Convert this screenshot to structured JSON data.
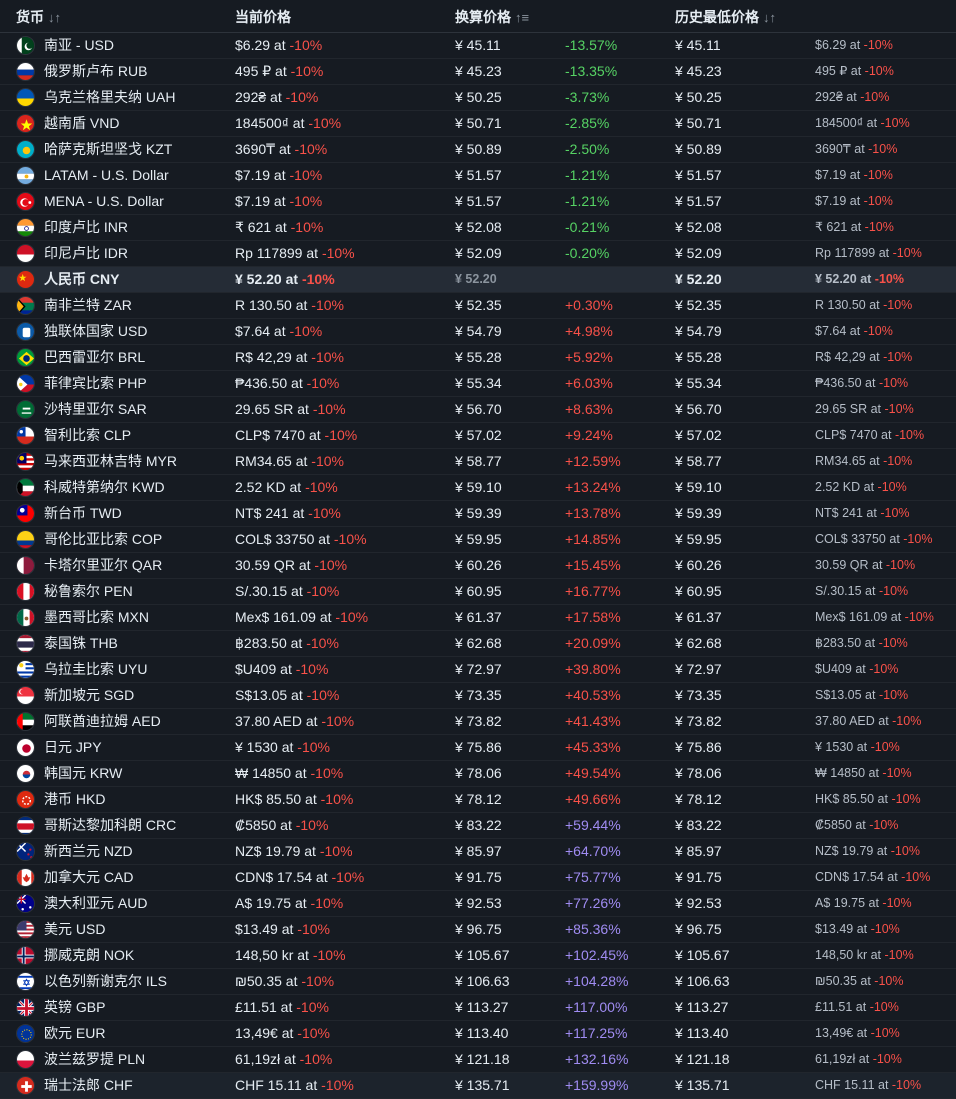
{
  "header": {
    "currency": "货币",
    "currency_sort": "↓↑",
    "current_price": "当前价格",
    "converted_price": "换算价格",
    "converted_sort": "↑≡",
    "lowest_price": "历史最低价格",
    "lowest_sort": "↓↑"
  },
  "sep_at": " at ",
  "rows": [
    {
      "name": "南亚 - USD",
      "price": "$6.29",
      "disc": "-10%",
      "conv": "¥ 45.11",
      "diff": "-13.57%",
      "dc": "green",
      "low": "¥ 45.11",
      "lowp": "$6.29",
      "lowd": "-10%",
      "flag": "pk"
    },
    {
      "name": "俄罗斯卢布 RUB",
      "price": "495 ₽",
      "disc": "-10%",
      "conv": "¥ 45.23",
      "diff": "-13.35%",
      "dc": "green",
      "low": "¥ 45.23",
      "lowp": "495 ₽",
      "lowd": "-10%",
      "flag": "ru"
    },
    {
      "name": "乌克兰格里夫纳 UAH",
      "price": "292₴",
      "disc": "-10%",
      "conv": "¥ 50.25",
      "diff": "-3.73%",
      "dc": "green",
      "low": "¥ 50.25",
      "lowp": "292₴",
      "lowd": "-10%",
      "flag": "ua"
    },
    {
      "name": "越南盾 VND",
      "price": "184500₫",
      "disc": "-10%",
      "conv": "¥ 50.71",
      "diff": "-2.85%",
      "dc": "green",
      "low": "¥ 50.71",
      "lowp": "184500₫",
      "lowd": "-10%",
      "flag": "vn"
    },
    {
      "name": "哈萨克斯坦坚戈 KZT",
      "price": "3690₸",
      "disc": "-10%",
      "conv": "¥ 50.89",
      "diff": "-2.50%",
      "dc": "green",
      "low": "¥ 50.89",
      "lowp": "3690₸",
      "lowd": "-10%",
      "flag": "kz"
    },
    {
      "name": "LATAM - U.S. Dollar",
      "price": "$7.19",
      "disc": "-10%",
      "conv": "¥ 51.57",
      "diff": "-1.21%",
      "dc": "green",
      "low": "¥ 51.57",
      "lowp": "$7.19",
      "lowd": "-10%",
      "flag": "ar"
    },
    {
      "name": "MENA - U.S. Dollar",
      "price": "$7.19",
      "disc": "-10%",
      "conv": "¥ 51.57",
      "diff": "-1.21%",
      "dc": "green",
      "low": "¥ 51.57",
      "lowp": "$7.19",
      "lowd": "-10%",
      "flag": "tr"
    },
    {
      "name": "印度卢比 INR",
      "price": "₹ 621",
      "disc": "-10%",
      "conv": "¥ 52.08",
      "diff": "-0.21%",
      "dc": "green",
      "low": "¥ 52.08",
      "lowp": "₹ 621",
      "lowd": "-10%",
      "flag": "in"
    },
    {
      "name": "印尼卢比 IDR",
      "price": "Rp 117899",
      "disc": "-10%",
      "conv": "¥ 52.09",
      "diff": "-0.20%",
      "dc": "green",
      "low": "¥ 52.09",
      "lowp": "Rp 117899",
      "lowd": "-10%",
      "flag": "id"
    },
    {
      "name": "人民币 CNY",
      "price": "¥ 52.20",
      "disc": "-10%",
      "conv": "¥ 52.20",
      "diff": "",
      "dc": "",
      "low": "¥ 52.20",
      "lowp": "¥ 52.20",
      "lowd": "-10%",
      "flag": "cn",
      "hl": true
    },
    {
      "name": "南非兰特 ZAR",
      "price": "R 130.50",
      "disc": "-10%",
      "conv": "¥ 52.35",
      "diff": "+0.30%",
      "dc": "red",
      "low": "¥ 52.35",
      "lowp": "R 130.50",
      "lowd": "-10%",
      "flag": "za"
    },
    {
      "name": "独联体国家 USD",
      "price": "$7.64",
      "disc": "-10%",
      "conv": "¥ 54.79",
      "diff": "+4.98%",
      "dc": "red",
      "low": "¥ 54.79",
      "lowp": "$7.64",
      "lowd": "-10%",
      "flag": "cis"
    },
    {
      "name": "巴西雷亚尔 BRL",
      "price": "R$ 42,29",
      "disc": "-10%",
      "conv": "¥ 55.28",
      "diff": "+5.92%",
      "dc": "red",
      "low": "¥ 55.28",
      "lowp": "R$ 42,29",
      "lowd": "-10%",
      "flag": "br"
    },
    {
      "name": "菲律宾比索 PHP",
      "price": "₱436.50",
      "disc": "-10%",
      "conv": "¥ 55.34",
      "diff": "+6.03%",
      "dc": "red",
      "low": "¥ 55.34",
      "lowp": "₱436.50",
      "lowd": "-10%",
      "flag": "ph"
    },
    {
      "name": "沙特里亚尔 SAR",
      "price": "29.65 SR",
      "disc": "-10%",
      "conv": "¥ 56.70",
      "diff": "+8.63%",
      "dc": "red",
      "low": "¥ 56.70",
      "lowp": "29.65 SR",
      "lowd": "-10%",
      "flag": "sa"
    },
    {
      "name": "智利比索 CLP",
      "price": "CLP$ 7470",
      "disc": "-10%",
      "conv": "¥ 57.02",
      "diff": "+9.24%",
      "dc": "red",
      "low": "¥ 57.02",
      "lowp": "CLP$ 7470",
      "lowd": "-10%",
      "flag": "cl"
    },
    {
      "name": "马来西亚林吉特 MYR",
      "price": "RM34.65",
      "disc": "-10%",
      "conv": "¥ 58.77",
      "diff": "+12.59%",
      "dc": "red",
      "low": "¥ 58.77",
      "lowp": "RM34.65",
      "lowd": "-10%",
      "flag": "my"
    },
    {
      "name": "科威特第纳尔 KWD",
      "price": "2.52 KD",
      "disc": "-10%",
      "conv": "¥ 59.10",
      "diff": "+13.24%",
      "dc": "red",
      "low": "¥ 59.10",
      "lowp": "2.52 KD",
      "lowd": "-10%",
      "flag": "kw"
    },
    {
      "name": "新台币 TWD",
      "price": "NT$ 241",
      "disc": "-10%",
      "conv": "¥ 59.39",
      "diff": "+13.78%",
      "dc": "red",
      "low": "¥ 59.39",
      "lowp": "NT$ 241",
      "lowd": "-10%",
      "flag": "tw"
    },
    {
      "name": "哥伦比亚比索 COP",
      "price": "COL$ 33750",
      "disc": "-10%",
      "conv": "¥ 59.95",
      "diff": "+14.85%",
      "dc": "red",
      "low": "¥ 59.95",
      "lowp": "COL$ 33750",
      "lowd": "-10%",
      "flag": "co"
    },
    {
      "name": "卡塔尔里亚尔 QAR",
      "price": "30.59 QR",
      "disc": "-10%",
      "conv": "¥ 60.26",
      "diff": "+15.45%",
      "dc": "red",
      "low": "¥ 60.26",
      "lowp": "30.59 QR",
      "lowd": "-10%",
      "flag": "qa"
    },
    {
      "name": "秘鲁索尔 PEN",
      "price": "S/.30.15",
      "disc": "-10%",
      "conv": "¥ 60.95",
      "diff": "+16.77%",
      "dc": "red",
      "low": "¥ 60.95",
      "lowp": "S/.30.15",
      "lowd": "-10%",
      "flag": "pe"
    },
    {
      "name": "墨西哥比索 MXN",
      "price": "Mex$ 161.09",
      "disc": "-10%",
      "conv": "¥ 61.37",
      "diff": "+17.58%",
      "dc": "red",
      "low": "¥ 61.37",
      "lowp": "Mex$ 161.09",
      "lowd": "-10%",
      "flag": "mx"
    },
    {
      "name": "泰国铢 THB",
      "price": "฿283.50",
      "disc": "-10%",
      "conv": "¥ 62.68",
      "diff": "+20.09%",
      "dc": "red",
      "low": "¥ 62.68",
      "lowp": "฿283.50",
      "lowd": "-10%",
      "flag": "th"
    },
    {
      "name": "乌拉圭比索 UYU",
      "price": "$U409",
      "disc": "-10%",
      "conv": "¥ 72.97",
      "diff": "+39.80%",
      "dc": "red",
      "low": "¥ 72.97",
      "lowp": "$U409",
      "lowd": "-10%",
      "flag": "uy"
    },
    {
      "name": "新加坡元 SGD",
      "price": "S$13.05",
      "disc": "-10%",
      "conv": "¥ 73.35",
      "diff": "+40.53%",
      "dc": "red",
      "low": "¥ 73.35",
      "lowp": "S$13.05",
      "lowd": "-10%",
      "flag": "sg"
    },
    {
      "name": "阿联酋迪拉姆 AED",
      "price": "37.80 AED",
      "disc": "-10%",
      "conv": "¥ 73.82",
      "diff": "+41.43%",
      "dc": "red",
      "low": "¥ 73.82",
      "lowp": "37.80 AED",
      "lowd": "-10%",
      "flag": "ae"
    },
    {
      "name": "日元 JPY",
      "price": "¥ 1530",
      "disc": "-10%",
      "conv": "¥ 75.86",
      "diff": "+45.33%",
      "dc": "red",
      "low": "¥ 75.86",
      "lowp": "¥ 1530",
      "lowd": "-10%",
      "flag": "jp"
    },
    {
      "name": "韩国元 KRW",
      "price": "₩ 14850",
      "disc": "-10%",
      "conv": "¥ 78.06",
      "diff": "+49.54%",
      "dc": "red",
      "low": "¥ 78.06",
      "lowp": "₩ 14850",
      "lowd": "-10%",
      "flag": "kr"
    },
    {
      "name": "港币 HKD",
      "price": "HK$ 85.50",
      "disc": "-10%",
      "conv": "¥ 78.12",
      "diff": "+49.66%",
      "dc": "red",
      "low": "¥ 78.12",
      "lowp": "HK$ 85.50",
      "lowd": "-10%",
      "flag": "hk"
    },
    {
      "name": "哥斯达黎加科朗 CRC",
      "price": "₡5850",
      "disc": "-10%",
      "conv": "¥ 83.22",
      "diff": "+59.44%",
      "dc": "purple",
      "low": "¥ 83.22",
      "lowp": "₡5850",
      "lowd": "-10%",
      "flag": "cr"
    },
    {
      "name": "新西兰元 NZD",
      "price": "NZ$ 19.79",
      "disc": "-10%",
      "conv": "¥ 85.97",
      "diff": "+64.70%",
      "dc": "purple",
      "low": "¥ 85.97",
      "lowp": "NZ$ 19.79",
      "lowd": "-10%",
      "flag": "nz"
    },
    {
      "name": "加拿大元 CAD",
      "price": "CDN$ 17.54",
      "disc": "-10%",
      "conv": "¥ 91.75",
      "diff": "+75.77%",
      "dc": "purple",
      "low": "¥ 91.75",
      "lowp": "CDN$ 17.54",
      "lowd": "-10%",
      "flag": "ca"
    },
    {
      "name": "澳大利亚元 AUD",
      "price": "A$ 19.75",
      "disc": "-10%",
      "conv": "¥ 92.53",
      "diff": "+77.26%",
      "dc": "purple",
      "low": "¥ 92.53",
      "lowp": "A$ 19.75",
      "lowd": "-10%",
      "flag": "au"
    },
    {
      "name": "美元 USD",
      "price": "$13.49",
      "disc": "-10%",
      "conv": "¥ 96.75",
      "diff": "+85.36%",
      "dc": "purple",
      "low": "¥ 96.75",
      "lowp": "$13.49",
      "lowd": "-10%",
      "flag": "us"
    },
    {
      "name": "挪威克朗 NOK",
      "price": "148,50 kr",
      "disc": "-10%",
      "conv": "¥ 105.67",
      "diff": "+102.45%",
      "dc": "purple",
      "low": "¥ 105.67",
      "lowp": "148,50 kr",
      "lowd": "-10%",
      "flag": "no"
    },
    {
      "name": "以色列新谢克尔 ILS",
      "price": "₪50.35",
      "disc": "-10%",
      "conv": "¥ 106.63",
      "diff": "+104.28%",
      "dc": "purple",
      "low": "¥ 106.63",
      "lowp": "₪50.35",
      "lowd": "-10%",
      "flag": "il"
    },
    {
      "name": "英镑 GBP",
      "price": "£11.51",
      "disc": "-10%",
      "conv": "¥ 113.27",
      "diff": "+117.00%",
      "dc": "purple",
      "low": "¥ 113.27",
      "lowp": "£11.51",
      "lowd": "-10%",
      "flag": "gb"
    },
    {
      "name": "欧元 EUR",
      "price": "13,49€",
      "disc": "-10%",
      "conv": "¥ 113.40",
      "diff": "+117.25%",
      "dc": "purple",
      "low": "¥ 113.40",
      "lowp": "13,49€",
      "lowd": "-10%",
      "flag": "eu"
    },
    {
      "name": "波兰兹罗提 PLN",
      "price": "61,19zł",
      "disc": "-10%",
      "conv": "¥ 121.18",
      "diff": "+132.16%",
      "dc": "purple",
      "low": "¥ 121.18",
      "lowp": "61,19zł",
      "lowd": "-10%",
      "flag": "pl"
    },
    {
      "name": "瑞士法郎 CHF",
      "price": "CHF 15.11",
      "disc": "-10%",
      "conv": "¥ 135.71",
      "diff": "+159.99%",
      "dc": "purple",
      "low": "¥ 135.71",
      "lowp": "CHF 15.11",
      "lowd": "-10%",
      "flag": "ch"
    }
  ]
}
